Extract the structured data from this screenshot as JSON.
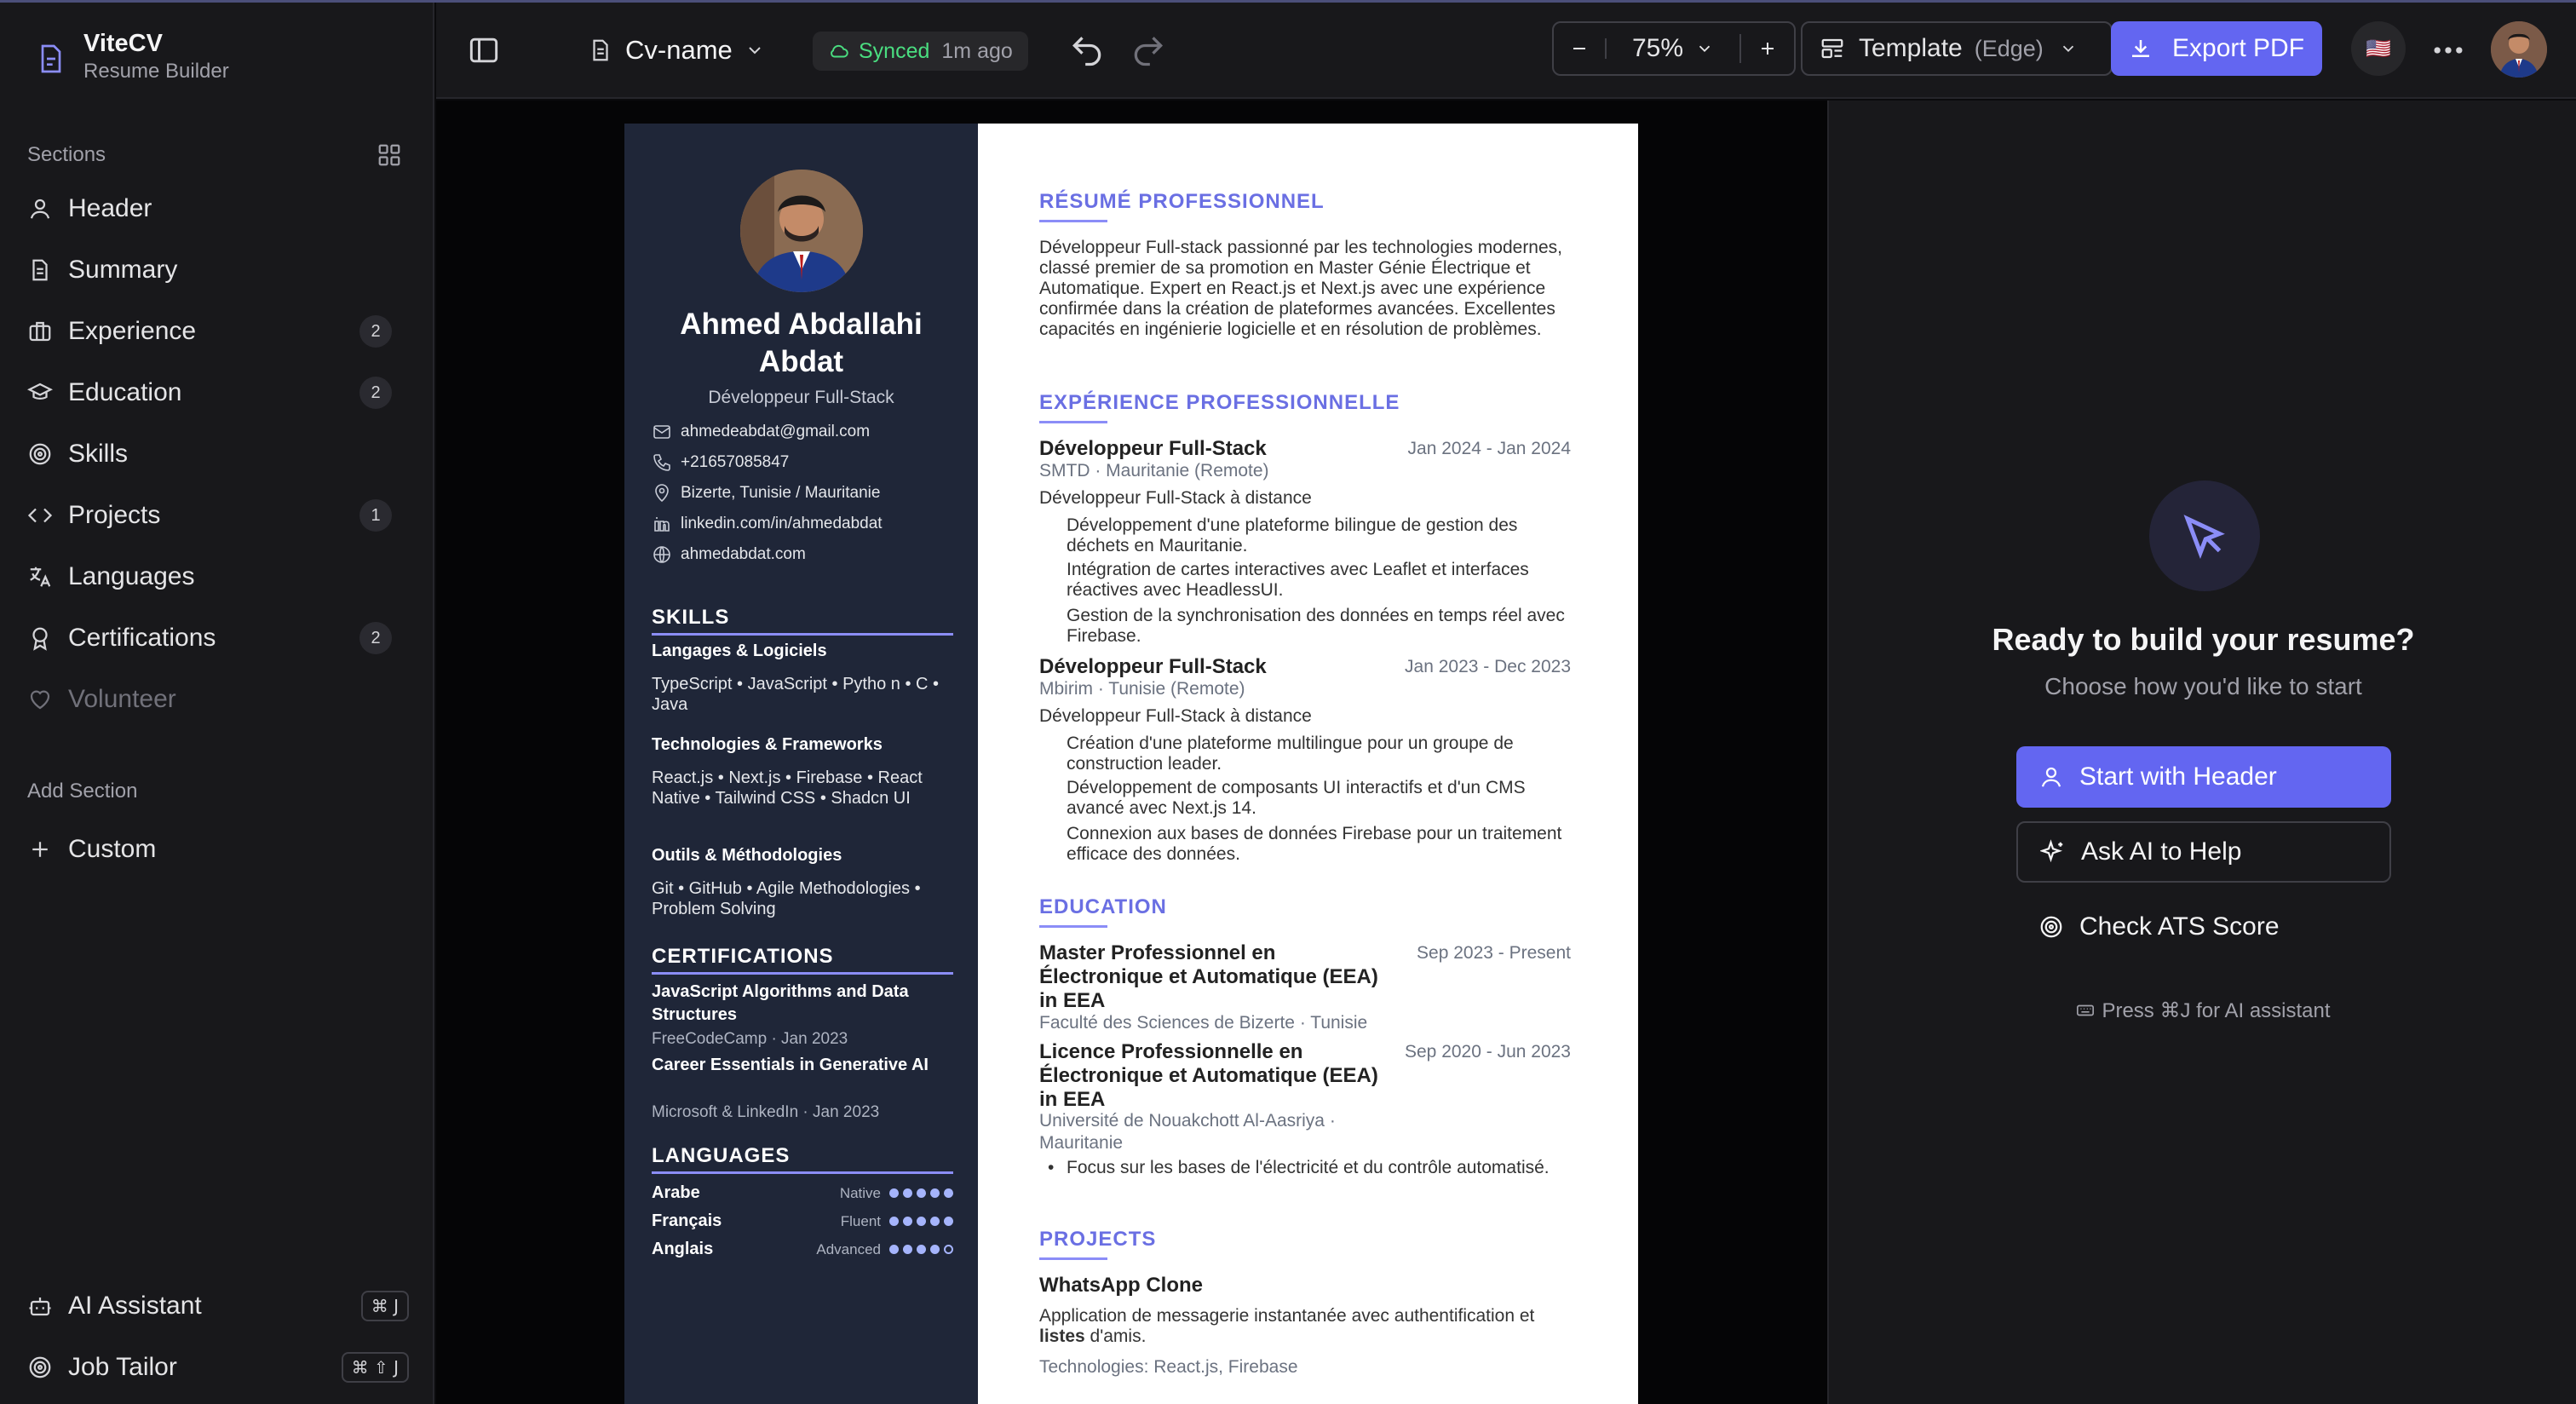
{
  "app": {
    "name": "ViteCV",
    "subtitle": "Resume Builder"
  },
  "sidebar": {
    "sections_title": "Sections",
    "items": [
      {
        "label": "Header",
        "count": ""
      },
      {
        "label": "Summary",
        "count": ""
      },
      {
        "label": "Experience",
        "count": "2"
      },
      {
        "label": "Education",
        "count": "2"
      },
      {
        "label": "Skills",
        "count": ""
      },
      {
        "label": "Projects",
        "count": "1"
      },
      {
        "label": "Languages",
        "count": ""
      },
      {
        "label": "Certifications",
        "count": "2"
      },
      {
        "label": "Volunteer",
        "count": ""
      }
    ],
    "add_section_title": "Add Section",
    "custom_label": "Custom",
    "ai_assistant": {
      "label": "AI Assistant",
      "shortcut": "⌘ J"
    },
    "job_tailor": {
      "label": "Job Tailor",
      "shortcut": "⌘ ⇧ J"
    }
  },
  "topbar": {
    "doc_name": "Cv-name",
    "sync_status": "Synced",
    "sync_time": "1m ago",
    "zoom": "75%",
    "template_label": "Template",
    "template_name": "(Edge)",
    "export_label": "Export PDF",
    "flag": "🇺🇸"
  },
  "resume": {
    "name": "Ahmed Abdallahi Abdat",
    "role": "Développeur Full-Stack",
    "contacts": {
      "email": "ahmedeabdat@gmail.com",
      "phone": "+21657085847",
      "location": "Bizerte, Tunisie / Mauritanie",
      "linkedin": "linkedin.com/in/ahmedabdat",
      "website": "ahmedabdat.com"
    },
    "skills_title": "SKILLS",
    "skills": [
      {
        "group": "Langages & Logiciels",
        "items": "TypeScript  •  JavaScript  •  Pytho n  •  C  •  Java"
      },
      {
        "group": "Technologies & Frameworks",
        "items": "React.js  •  Next.js  •  Firebase  •  React Native  •  Tailwind CSS  •  Shadcn UI"
      },
      {
        "group": "Outils & Méthodologies",
        "items": "Git  •  GitHub  •  Agile Methodologies  •  Problem Solving"
      }
    ],
    "certifications_title": "CERTIFICATIONS",
    "certifications": [
      {
        "name": "JavaScript Algorithms and Data Structures",
        "meta": "FreeCodeCamp · Jan 2023"
      },
      {
        "name": "Career Essentials in Generative AI",
        "meta": "Microsoft & LinkedIn · Jan 2023"
      }
    ],
    "languages_title": "LANGUAGES",
    "languages": [
      {
        "name": "Arabe",
        "level": "Native",
        "dots": 5
      },
      {
        "name": "Français",
        "level": "Fluent",
        "dots": 5
      },
      {
        "name": "Anglais",
        "level": "Advanced",
        "dots": 4
      }
    ],
    "summary_title": "RÉSUMÉ PROFESSIONNEL",
    "summary": "Développeur Full-stack passionné par les technologies modernes, classé premier de sa promotion en Master Génie Électrique et Automatique. Expert en React.js et Next.js avec une expérience confirmée dans la création de plateformes avancées. Excellentes capacités en ingénierie logicielle et en résolution de problèmes.",
    "experience_title": "EXPÉRIENCE PROFESSIONNELLE",
    "experience": [
      {
        "title": "Développeur Full-Stack",
        "dates": "Jan 2024 - Jan 2024",
        "company": "SMTD · Mauritanie (Remote)",
        "type": "Développeur Full-Stack à distance",
        "bullets": [
          "Développement d'une plateforme bilingue de gestion des déchets en Mauritanie.",
          "Intégration de cartes interactives avec Leaflet et interfaces réactives avec HeadlessUI.",
          "Gestion de la synchronisation des données en temps réel avec Firebase."
        ]
      },
      {
        "title": "Développeur Full-Stack",
        "dates": "Jan 2023 - Dec 2023",
        "company": "Mbirim · Tunisie (Remote)",
        "type": "Développeur Full-Stack à distance",
        "bullets": [
          "Création d'une plateforme multilingue pour un groupe de construction leader.",
          "Développement de composants UI interactifs et d'un CMS avancé avec Next.js 14.",
          "Connexion aux bases de données Firebase pour un traitement efficace des données."
        ]
      }
    ],
    "education_title": "EDUCATION",
    "education": [
      {
        "degree": "Master Professionnel en Électronique et Automatique (EEA) in EEA",
        "dates": "Sep 2023 - Present",
        "school": "Faculté des Sciences de Bizerte · Tunisie"
      },
      {
        "degree": "Licence Professionnelle en Électronique et Automatique (EEA) in EEA",
        "dates": "Sep 2020 - Jun 2023",
        "school": "Université de Nouakchott Al-Aasriya · Mauritanie",
        "bullet": "Focus sur les bases de l'électricité et du contrôle automatisé."
      }
    ],
    "projects_title": "PROJECTS",
    "projects": [
      {
        "name": "WhatsApp Clone",
        "desc_start": "Application de messagerie instantanée avec authentification et ",
        "desc_bold": "listes",
        "desc_end": " d'amis.",
        "tech_label": "Technologies:",
        "tech": "React.js, Firebase"
      }
    ]
  },
  "panel": {
    "title": "Ready to build your resume?",
    "subtitle": "Choose how you'd like to start",
    "start_label": "Start with Header",
    "ai_label": "Ask AI to Help",
    "ats_label": "Check ATS Score",
    "hint": "Press ⌘J for AI assistant"
  },
  "colors": {
    "accent": "#6366f1",
    "resume_sidebar": "#1f2638",
    "synced": "#4ade80"
  }
}
